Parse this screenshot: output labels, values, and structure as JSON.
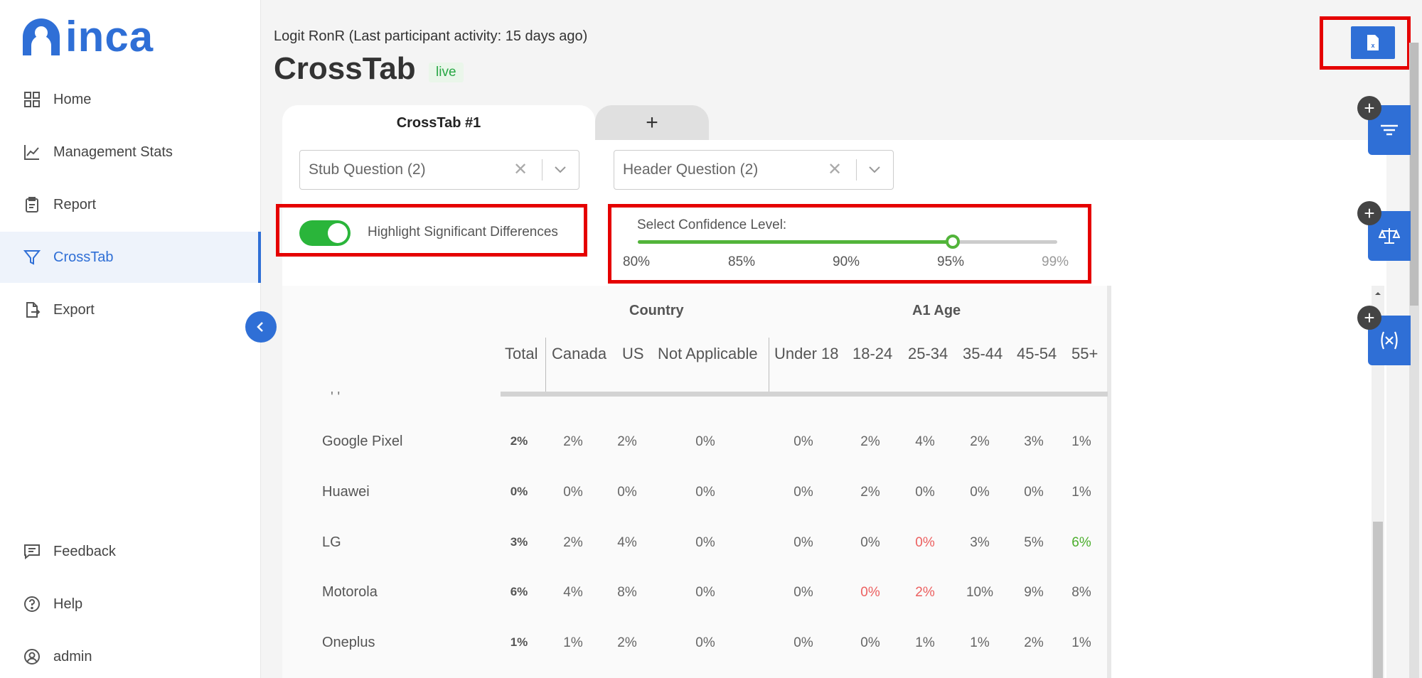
{
  "brand": {
    "name": "inca",
    "color": "#2f6fd6"
  },
  "nav": {
    "items": [
      {
        "label": "Home",
        "icon": "grid-icon"
      },
      {
        "label": "Management Stats",
        "icon": "line-chart-icon"
      },
      {
        "label": "Report",
        "icon": "clipboard-icon"
      },
      {
        "label": "CrossTab",
        "icon": "filter-icon",
        "active": true
      },
      {
        "label": "Export",
        "icon": "export-file-icon"
      }
    ],
    "bottom": [
      {
        "label": "Feedback",
        "icon": "feedback-icon"
      },
      {
        "label": "Help",
        "icon": "help-icon"
      },
      {
        "label": "admin",
        "icon": "user-icon"
      }
    ]
  },
  "header": {
    "activity": "Logit RonR (Last participant activity: 15 days ago)",
    "title": "CrossTab",
    "status": "live"
  },
  "tabs": {
    "active_label": "CrossTab #1",
    "add_label": "+"
  },
  "filters": {
    "stub": "Stub Question (2)",
    "header": "Header Question (2)"
  },
  "highlight": {
    "label": "Highlight Significant Differences",
    "enabled": true
  },
  "confidence": {
    "label": "Select Confidence Level:",
    "marks": [
      "80%",
      "85%",
      "90%",
      "95%",
      "99%"
    ],
    "selected": "95%",
    "fill_fraction": 0.75
  },
  "table": {
    "groups": [
      "Country",
      "A1 Age"
    ],
    "columns": [
      "Total",
      "Canada",
      "US",
      "Not Applicable",
      "Under 18",
      "18-24",
      "25-34",
      "35-44",
      "45-54",
      "55+"
    ],
    "partial_row": "' '",
    "rows": [
      {
        "label": "Google Pixel",
        "values": [
          "2%",
          "2%",
          "2%",
          "0%",
          "0%",
          "2%",
          "4%",
          "2%",
          "3%",
          "1%"
        ],
        "styles": [
          "",
          "",
          "",
          "",
          "",
          "",
          "",
          "",
          "",
          ""
        ]
      },
      {
        "label": "Huawei",
        "values": [
          "0%",
          "0%",
          "0%",
          "0%",
          "0%",
          "2%",
          "0%",
          "0%",
          "0%",
          "1%"
        ],
        "styles": [
          "",
          "",
          "",
          "",
          "",
          "",
          "",
          "",
          "",
          ""
        ]
      },
      {
        "label": "LG",
        "values": [
          "3%",
          "2%",
          "4%",
          "0%",
          "0%",
          "0%",
          "0%",
          "3%",
          "5%",
          "6%"
        ],
        "styles": [
          "",
          "",
          "",
          "",
          "",
          "",
          "red",
          "",
          "",
          "green"
        ]
      },
      {
        "label": "Motorola",
        "values": [
          "6%",
          "4%",
          "8%",
          "0%",
          "0%",
          "0%",
          "2%",
          "10%",
          "9%",
          "8%"
        ],
        "styles": [
          "",
          "",
          "",
          "",
          "",
          "red",
          "red",
          "",
          "",
          ""
        ]
      },
      {
        "label": "Oneplus",
        "values": [
          "1%",
          "1%",
          "2%",
          "0%",
          "0%",
          "0%",
          "1%",
          "1%",
          "2%",
          "1%"
        ],
        "styles": [
          "",
          "",
          "",
          "",
          "",
          "",
          "",
          "",
          "",
          ""
        ]
      }
    ]
  },
  "side_panel": {
    "tabs": [
      {
        "icon": "filter-lines-icon"
      },
      {
        "icon": "scale-icon"
      },
      {
        "icon": "variable-icon"
      }
    ],
    "add_label": "+"
  },
  "toolbar": {
    "excel_icon": "excel-file-icon"
  },
  "colors": {
    "accent": "#2f6fd6",
    "toggle_on": "#2ab53a",
    "slider": "#52b43a",
    "sig_low": "#ec6060",
    "sig_high": "#4cae2d",
    "annotation": "#e50000"
  }
}
